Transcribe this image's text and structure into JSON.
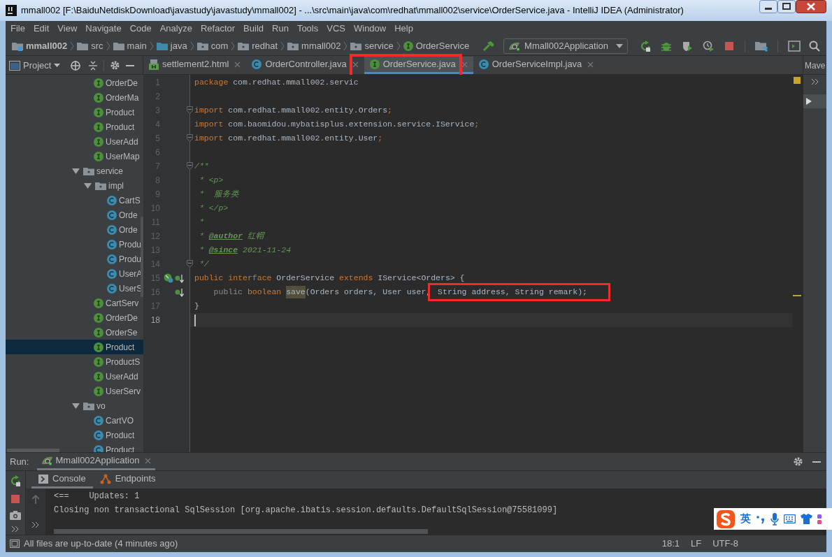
{
  "window": {
    "title": "mmall002 [F:\\BaiduNetdiskDownload\\javastudy\\javastudy\\mmall002] - ...\\src\\main\\java\\com\\redhat\\mmall002\\service\\OrderService.java - IntelliJ IDEA (Administrator)"
  },
  "menu": [
    "File",
    "Edit",
    "View",
    "Navigate",
    "Code",
    "Analyze",
    "Refactor",
    "Build",
    "Run",
    "Tools",
    "VCS",
    "Window",
    "Help"
  ],
  "breadcrumbs": [
    {
      "label": "mmall002",
      "kind": "module"
    },
    {
      "label": "src",
      "kind": "folder"
    },
    {
      "label": "main",
      "kind": "folder"
    },
    {
      "label": "java",
      "kind": "source"
    },
    {
      "label": "com",
      "kind": "package"
    },
    {
      "label": "redhat",
      "kind": "package"
    },
    {
      "label": "mmall002",
      "kind": "package"
    },
    {
      "label": "service",
      "kind": "package"
    },
    {
      "label": "OrderService",
      "kind": "interface"
    }
  ],
  "run_config": "Mmall002Application",
  "project_panel": {
    "title": "Project"
  },
  "tabs": [
    {
      "label": "settlement2.html",
      "kind": "html",
      "selected": false,
      "highlighted": false
    },
    {
      "label": "OrderController.java",
      "kind": "class",
      "selected": false,
      "highlighted": false
    },
    {
      "label": "OrderService.java",
      "kind": "interface",
      "selected": true,
      "highlighted": true
    },
    {
      "label": "OrderServiceImpl.java",
      "kind": "class",
      "selected": false,
      "highlighted": false
    }
  ],
  "side_panel": {
    "title": "Mave"
  },
  "tree": [
    {
      "label": "OrderDe",
      "kind": "interface",
      "selected": false
    },
    {
      "label": "OrderMa",
      "kind": "interface",
      "selected": false
    },
    {
      "label": "Product",
      "kind": "interface",
      "selected": false
    },
    {
      "label": "Product",
      "kind": "interface",
      "selected": false
    },
    {
      "label": "UserAdd",
      "kind": "interface",
      "selected": false
    },
    {
      "label": "UserMap",
      "kind": "interface",
      "selected": false
    },
    {
      "label": "service",
      "kind": "package",
      "expanded": true,
      "selected": false,
      "children": [
        {
          "label": "impl",
          "kind": "package",
          "expanded": true,
          "selected": false,
          "children": [
            {
              "label": "CartS",
              "kind": "class",
              "selected": false
            },
            {
              "label": "Orde",
              "kind": "class",
              "selected": false
            },
            {
              "label": "Orde",
              "kind": "class",
              "selected": false
            },
            {
              "label": "Produ",
              "kind": "class",
              "selected": false
            },
            {
              "label": "Produ",
              "kind": "class",
              "selected": false
            },
            {
              "label": "UserA",
              "kind": "class",
              "selected": false
            },
            {
              "label": "UserS",
              "kind": "class",
              "selected": false
            }
          ]
        },
        {
          "label": "CartServ",
          "kind": "interface",
          "selected": false
        },
        {
          "label": "OrderDe",
          "kind": "interface",
          "selected": false
        },
        {
          "label": "OrderSe",
          "kind": "interface",
          "selected": false
        },
        {
          "label": "Product",
          "kind": "interface",
          "selected": true
        },
        {
          "label": "ProductS",
          "kind": "interface",
          "selected": false
        },
        {
          "label": "UserAdd",
          "kind": "interface",
          "selected": false
        },
        {
          "label": "UserServ",
          "kind": "interface",
          "selected": false
        }
      ]
    },
    {
      "label": "vo",
      "kind": "package",
      "expanded": true,
      "selected": false,
      "children": [
        {
          "label": "CartVO",
          "kind": "class",
          "selected": false
        },
        {
          "label": "Product",
          "kind": "class",
          "selected": false
        },
        {
          "label": "Product",
          "kind": "class",
          "selected": false
        }
      ]
    }
  ],
  "editor": {
    "lines": [
      {
        "number": "1",
        "tokens": [
          {
            "text": "package",
            "kind": "keyword"
          },
          {
            "text": " com.redhat.mmall002.servic",
            "kind": "plain"
          }
        ]
      },
      {
        "number": "2"
      },
      {
        "number": "3",
        "fold": true,
        "tokens": [
          {
            "text": "import",
            "kind": "keyword"
          },
          {
            "text": " com.redhat.mmall002.entity.Orders",
            "kind": "plain"
          },
          {
            "text": ";",
            "kind": "keyword"
          }
        ]
      },
      {
        "number": "4",
        "tokens": [
          {
            "text": "import",
            "kind": "keyword"
          },
          {
            "text": " com.baomidou.mybatisplus.extension.service.IService",
            "kind": "plain"
          },
          {
            "text": ";",
            "kind": "keyword"
          }
        ]
      },
      {
        "number": "5",
        "fold": true,
        "tokens": [
          {
            "text": "import",
            "kind": "keyword"
          },
          {
            "text": " com.redhat.mmall002.entity.User",
            "kind": "plain"
          },
          {
            "text": ";",
            "kind": "keyword"
          }
        ]
      },
      {
        "number": "6"
      },
      {
        "number": "7",
        "fold": true,
        "tokens": [
          {
            "text": "/**",
            "kind": "doc"
          }
        ]
      },
      {
        "number": "8",
        "tokens": [
          {
            "text": " * <p>",
            "kind": "doc"
          }
        ]
      },
      {
        "number": "9",
        "tokens": [
          {
            "text": " *  服务类",
            "kind": "doc"
          }
        ]
      },
      {
        "number": "10",
        "tokens": [
          {
            "text": " * </p>",
            "kind": "doc"
          }
        ]
      },
      {
        "number": "11",
        "tokens": [
          {
            "text": " *",
            "kind": "doc"
          }
        ]
      },
      {
        "number": "12",
        "tokens": [
          {
            "text": " * ",
            "kind": "doc"
          },
          {
            "text": "@author",
            "kind": "doctag"
          },
          {
            "text": " 红帽",
            "kind": "doc"
          }
        ]
      },
      {
        "number": "13",
        "tokens": [
          {
            "text": " * ",
            "kind": "doc"
          },
          {
            "text": "@since",
            "kind": "doctag"
          },
          {
            "text": " 2021-11-24",
            "kind": "doc"
          }
        ]
      },
      {
        "number": "14",
        "fold": true,
        "tokens": [
          {
            "text": " */",
            "kind": "doc"
          }
        ]
      },
      {
        "number": "15",
        "gutter_marks": [
          {
            "kind": "implemented"
          },
          {
            "kind": "implementing"
          }
        ],
        "tokens": [
          {
            "text": "public",
            "kind": "keyword"
          },
          {
            "text": " interface",
            "kind": "keyword"
          },
          {
            "text": " OrderService ",
            "kind": "plain"
          },
          {
            "text": "extends",
            "kind": "keyword"
          },
          {
            "text": " IService<Orders> {",
            "kind": "plain"
          }
        ]
      },
      {
        "number": "16",
        "gutter_marks": [
          {
            "kind": "implementing"
          }
        ],
        "tokens": [
          {
            "text": "    public",
            "kind": "unused"
          },
          {
            "text": " boolean ",
            "kind": "keyword"
          },
          {
            "text": "save",
            "kind": "usage"
          },
          {
            "text": "(Orders orders, User user,",
            "kind": "plain"
          },
          {
            "text": " String address, String remark);",
            "kind": "boxed"
          }
        ]
      },
      {
        "number": "17",
        "tokens": [
          {
            "text": "}",
            "kind": "plain"
          }
        ]
      },
      {
        "number": "18",
        "current": true
      }
    ]
  },
  "run_panel": {
    "label": "Run:",
    "tab": "Mmall002Application",
    "subtabs": [
      {
        "label": "Console",
        "kind": "console",
        "selected": true
      },
      {
        "label": "Endpoints",
        "kind": "endpoints",
        "selected": false
      }
    ],
    "console": [
      "<==    Updates: 1",
      "Closing non transactional SqlSession [org.apache.ibatis.session.defaults.DefaultSqlSession@75581099]"
    ]
  },
  "status_bar": {
    "message": "All files are up-to-date (4 minutes ago)",
    "items": [
      "18:1",
      "LF",
      "UTF-8"
    ]
  },
  "ime": {
    "mode": "英"
  }
}
